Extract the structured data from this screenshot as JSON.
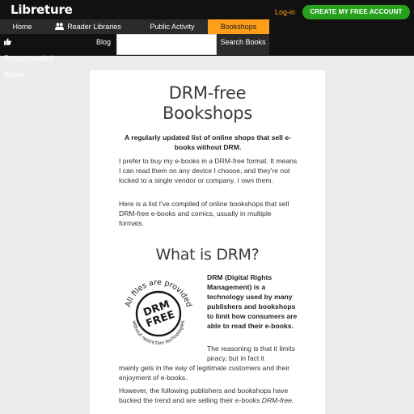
{
  "header": {
    "logo": "Libreture",
    "login": "Log-in",
    "cta": "CREATE MY FREE ACCOUNT",
    "nav": [
      {
        "label": "Home"
      },
      {
        "label": "Reader Libraries",
        "icon": "users-icon"
      },
      {
        "label": "Public Activity"
      },
      {
        "label": "Bookshops",
        "active": true
      }
    ],
    "subnav": [
      {
        "label": "Recommended Books",
        "icon": "thumbs-up-icon"
      },
      {
        "label": "Blog"
      }
    ],
    "search": {
      "placeholder": "",
      "button": "Search Books"
    }
  },
  "colors": {
    "accent": "#ff9e18",
    "cta": "#27a11d",
    "topbar": "#111111"
  },
  "article": {
    "title_line1": "DRM-free",
    "title_line2": "Bookshops",
    "lead": "A regularly updated list of online shops that sell e-books without DRM.",
    "p1": "I prefer to buy my e-books in a DRM-free format. It means I can read them on any device I choose, and they're not locked to a single vendor or company. I own them.",
    "p2": "Here is a list I've compiled of online bookshops that sell DRM-free e-books and comics, usually in multiple formats.",
    "h2": "What is DRM?",
    "badge": {
      "top": "All files are provided",
      "center1": "DRM",
      "center2": "FREE",
      "bottom": "without restrictive technologies"
    },
    "drm_def": "DRM (Digital Rights Management) is a technology used by many publishers and bookshops to limit how consumers are able to read their e-books.",
    "reason_a": "The reasoning is that it limits piracy, but in fact it",
    "reason_b": "mainly gets in the way of legitimate customers and their enjoyment of e-books.",
    "however": "However, the following publishers and bookshops have bucked the trend and are selling their e-books",
    "however_em": "DRM-free."
  }
}
